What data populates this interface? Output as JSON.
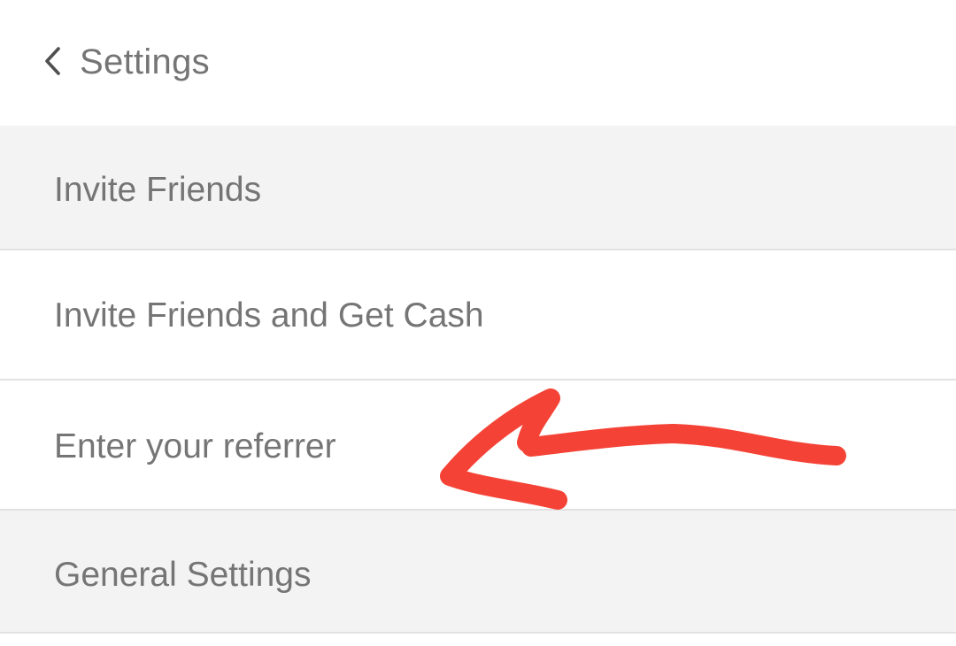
{
  "header": {
    "title": "Settings",
    "back_icon": "chevron-left-icon"
  },
  "rows": [
    {
      "label": "Invite Friends",
      "kind": "section-header"
    },
    {
      "label": "Invite Friends and Get Cash",
      "kind": "item"
    },
    {
      "label": "Enter your referrer",
      "kind": "item"
    },
    {
      "label": "General Settings",
      "kind": "section-header"
    }
  ],
  "colors": {
    "text": "#757575",
    "section_background": "#f3f3f3",
    "item_background": "#ffffff",
    "divider": "#e2e2e2",
    "annotation_arrow": "#f44336"
  },
  "annotation": {
    "type": "hand-drawn-arrow",
    "points_to": "Enter your referrer"
  }
}
